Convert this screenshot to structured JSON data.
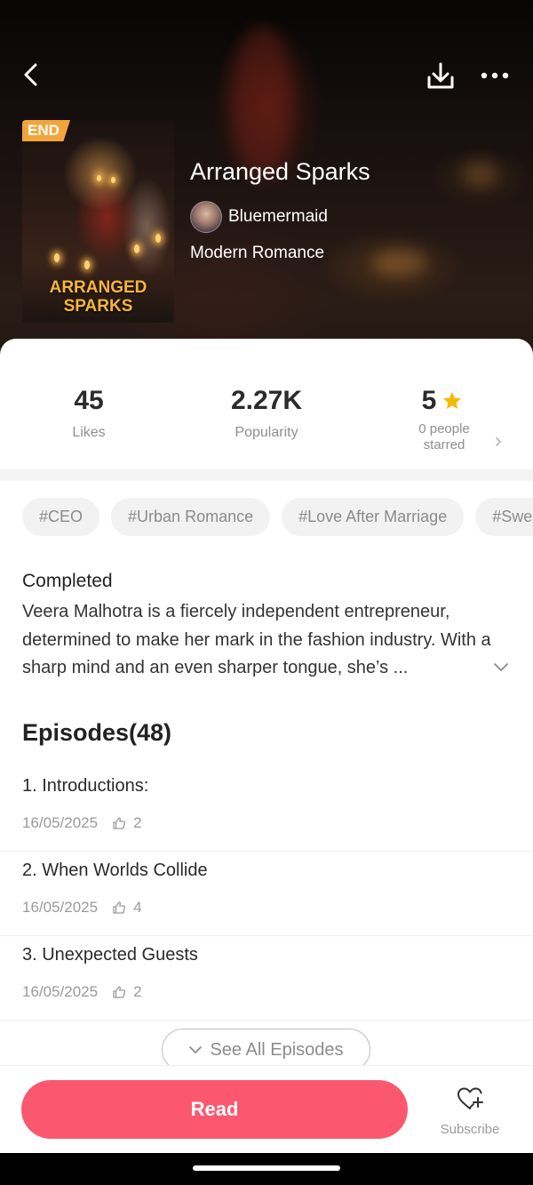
{
  "header": {
    "back_icon": "chevron-left-icon",
    "download_icon": "download-icon",
    "more_icon": "more-dots-icon"
  },
  "book": {
    "badge": "END",
    "cover_title_line1": "ARRANGED",
    "cover_title_line2": "SPARKS",
    "title": "Arranged Sparks",
    "author": "Bluemermaid",
    "genre": "Modern Romance"
  },
  "stats": {
    "likes_value": "45",
    "likes_label": "Likes",
    "popularity_value": "2.27K",
    "popularity_label": "Popularity",
    "rating_value": "5",
    "rating_label": "0 people starred",
    "star_color": "#f5b800"
  },
  "tags": [
    "#CEO",
    "#Urban Romance",
    "#Love After Marriage",
    "#Sweet"
  ],
  "status": "Completed",
  "synopsis": "Veera Malhotra is a fiercely independent entrepreneur, determined to make her mark in the fashion industry. With a sharp mind and an even sharper tongue, she’s ...",
  "episodes": {
    "heading": "Episodes(48)",
    "items": [
      {
        "title": "1. Introductions:",
        "date": "16/05/2025",
        "likes": "2"
      },
      {
        "title": "2. When Worlds Collide",
        "date": "16/05/2025",
        "likes": "4"
      },
      {
        "title": "3. Unexpected Guests",
        "date": "16/05/2025",
        "likes": "2"
      }
    ],
    "see_all_label": "See All Episodes"
  },
  "actions": {
    "read_label": "Read",
    "subscribe_label": "Subscribe",
    "accent_color": "#fb5870"
  }
}
